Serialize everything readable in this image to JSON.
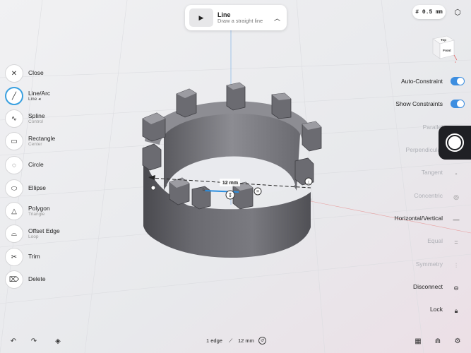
{
  "tool": {
    "name": "Line",
    "description": "Draw a straight line",
    "play_icon": "play-icon",
    "chevron_icon": "chevron-up-icon"
  },
  "grid": {
    "size": "# 0.5 mm"
  },
  "viewcube": {
    "top": "Top",
    "front": "Front"
  },
  "dimension": {
    "label": "12 mm"
  },
  "left_toolbar": [
    {
      "label": "Close",
      "sub": "",
      "icon": "close-icon",
      "glyph": "✕"
    },
    {
      "label": "Line/Arc",
      "sub": "Line ◂",
      "icon": "line-icon",
      "glyph": "╱",
      "active": true
    },
    {
      "label": "Spline",
      "sub": "Control",
      "icon": "spline-icon",
      "glyph": "∿"
    },
    {
      "label": "Rectangle",
      "sub": "Center",
      "icon": "rectangle-icon",
      "glyph": "▭"
    },
    {
      "label": "Circle",
      "sub": "",
      "icon": "circle-icon",
      "glyph": "◌"
    },
    {
      "label": "Ellipse",
      "sub": "",
      "icon": "ellipse-icon",
      "glyph": "⬭"
    },
    {
      "label": "Polygon",
      "sub": "Triangle",
      "icon": "polygon-icon",
      "glyph": "△"
    },
    {
      "label": "Offset Edge",
      "sub": "Loop",
      "icon": "offset-edge-icon",
      "glyph": "⌓"
    },
    {
      "label": "Trim",
      "sub": "",
      "icon": "trim-icon",
      "glyph": "✂"
    },
    {
      "label": "Delete",
      "sub": "",
      "icon": "delete-icon",
      "glyph": "⌦"
    }
  ],
  "constraints": {
    "auto_constraint": "Auto-Constraint",
    "show_constraints": "Show Constraints",
    "parallel": "Parallel",
    "perpendicular": "Perpendicular",
    "tangent": "Tangent",
    "concentric": "Concentric",
    "horizontal_vertical": "Horizontal/Vertical",
    "equal": "Equal",
    "symmetry": "Symmetry",
    "disconnect": "Disconnect",
    "lock": "Lock"
  },
  "toggles": {
    "auto_constraint": true,
    "show_constraints": true
  },
  "status": {
    "selection": "1 edge",
    "length": "12 mm"
  },
  "colors": {
    "accent": "#3d8ee0",
    "model": "#5d5d62",
    "background": "#ecedef"
  }
}
